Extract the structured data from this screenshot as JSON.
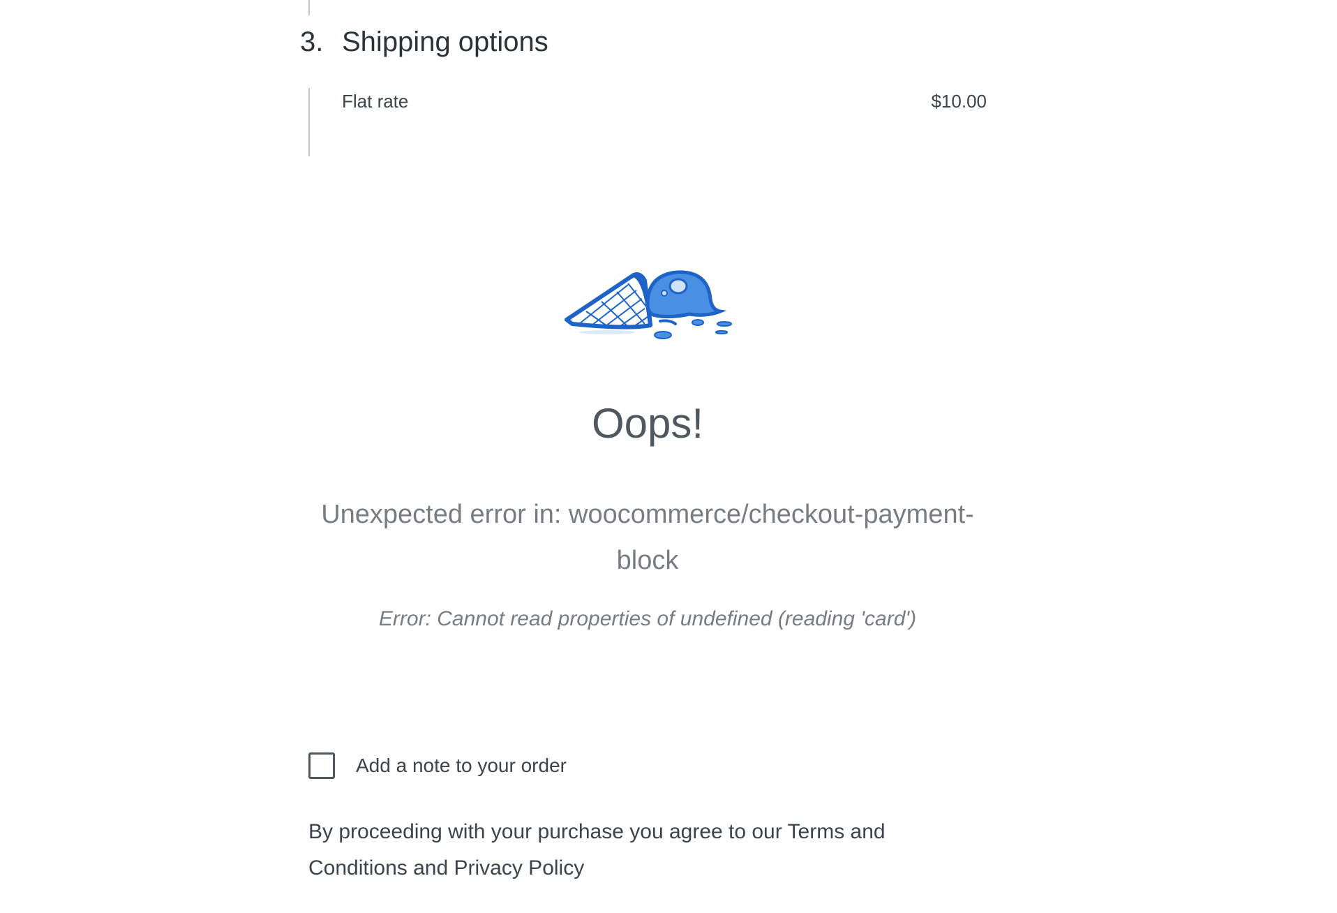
{
  "shipping_step": {
    "number": "3.",
    "title": "Shipping options",
    "option": {
      "label": "Flat rate",
      "price": "$10.00"
    }
  },
  "error_panel": {
    "illustration": "melted-ice-cream-icon",
    "title": "Oops!",
    "message": "Unexpected error in: woocommerce/checkout-payment-block",
    "detail": "Error: Cannot read properties of undefined (reading 'card')"
  },
  "order_note": {
    "label": "Add a note to your order",
    "checked": false
  },
  "terms": {
    "prefix": "By proceeding with your purchase you agree to our ",
    "terms_link": "Terms and Conditions",
    "middle": " and ",
    "privacy_link": "Privacy Policy"
  },
  "colors": {
    "illustration_blue": "#1e64c8",
    "text_dark": "#3c434a",
    "text_muted": "#787c82"
  }
}
